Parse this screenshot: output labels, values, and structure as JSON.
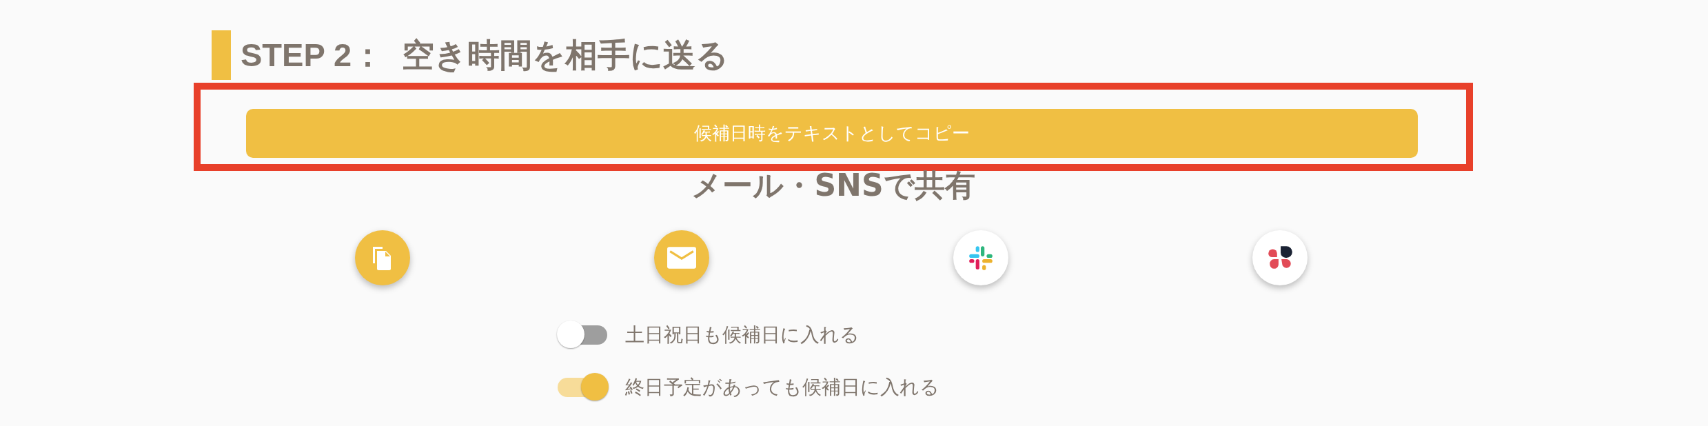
{
  "step": {
    "title": "STEP 2：  空き時間を相手に送る"
  },
  "copy": {
    "label": "候補日時をテキストとしてコピー",
    "highlighted": true
  },
  "share": {
    "heading": "メール・SNSで共有",
    "buttons": [
      {
        "kind": "copy"
      },
      {
        "kind": "mail"
      },
      {
        "kind": "slack"
      },
      {
        "kind": "petals"
      }
    ]
  },
  "toggles": [
    {
      "label": "土日祝日も候補日に入れる",
      "on": false
    },
    {
      "label": "終日予定があっても候補日に入れる",
      "on": true
    }
  ]
}
